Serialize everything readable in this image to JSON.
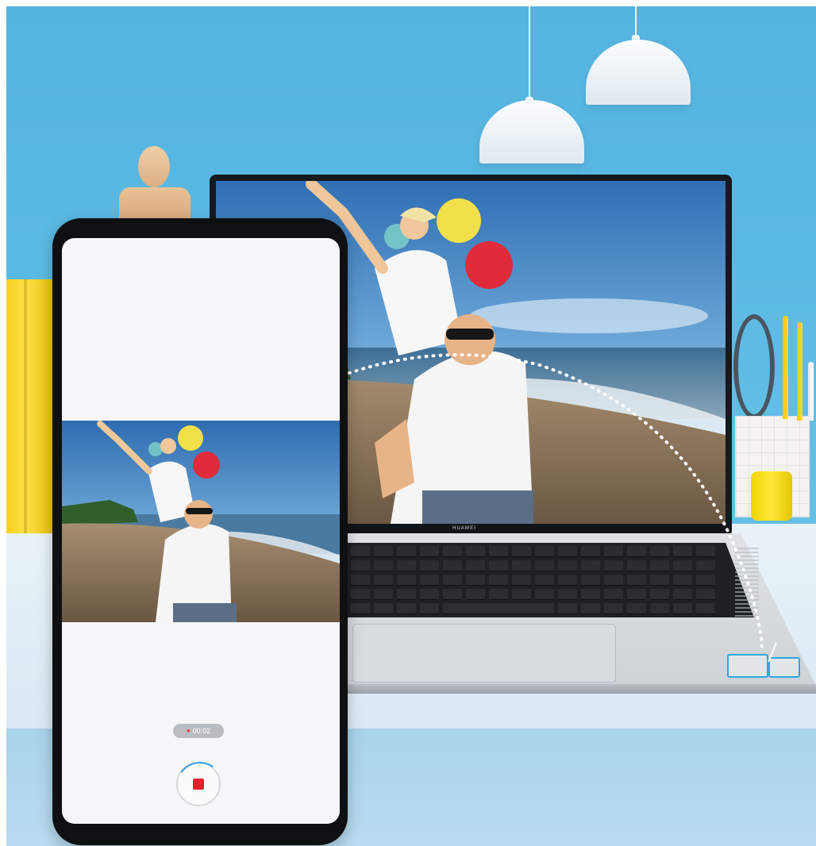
{
  "laptop": {
    "brand": "HUAWEI"
  },
  "phone": {
    "recording": {
      "timer": "00:02",
      "indicator_color": "#e53935",
      "stop_button_color": "#e0232b",
      "progress_color": "#3aa0e0"
    }
  },
  "scene": {
    "wall_color": "#5ab9e3",
    "desk_color": "#e4eef5",
    "accent_yellow": "#f6d21c",
    "nfc_color": "#2fa6dd"
  },
  "icons": [
    "stop-icon",
    "record-dot-icon",
    "nfc-icon",
    "pendant-lamp",
    "beach-photo"
  ]
}
